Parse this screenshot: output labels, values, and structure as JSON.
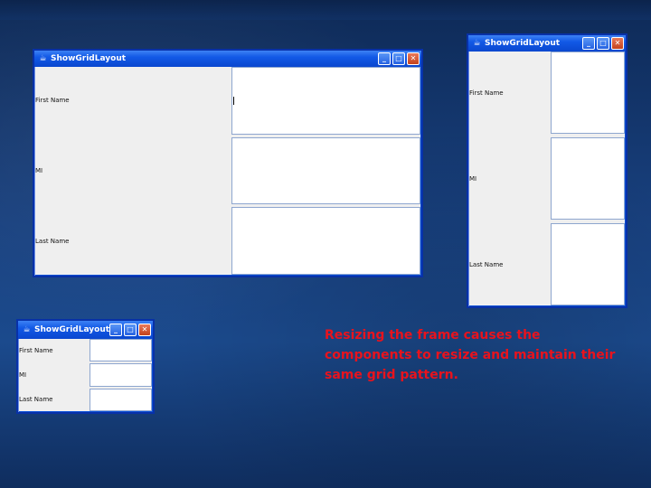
{
  "window_title": "ShowGridLayout",
  "labels": {
    "first_name": "First Name",
    "mi": "MI",
    "last_name": "Last Name"
  },
  "caption": "Resizing the frame causes the components to resize and maintain their same grid pattern.",
  "colors": {
    "caption": "#e8131d",
    "titlebar": "#0a47cf",
    "background": "#18407e"
  },
  "icons": {
    "app": "java-cup-icon",
    "minimize": "minimize-icon",
    "maximize": "maximize-icon",
    "close": "close-icon"
  }
}
